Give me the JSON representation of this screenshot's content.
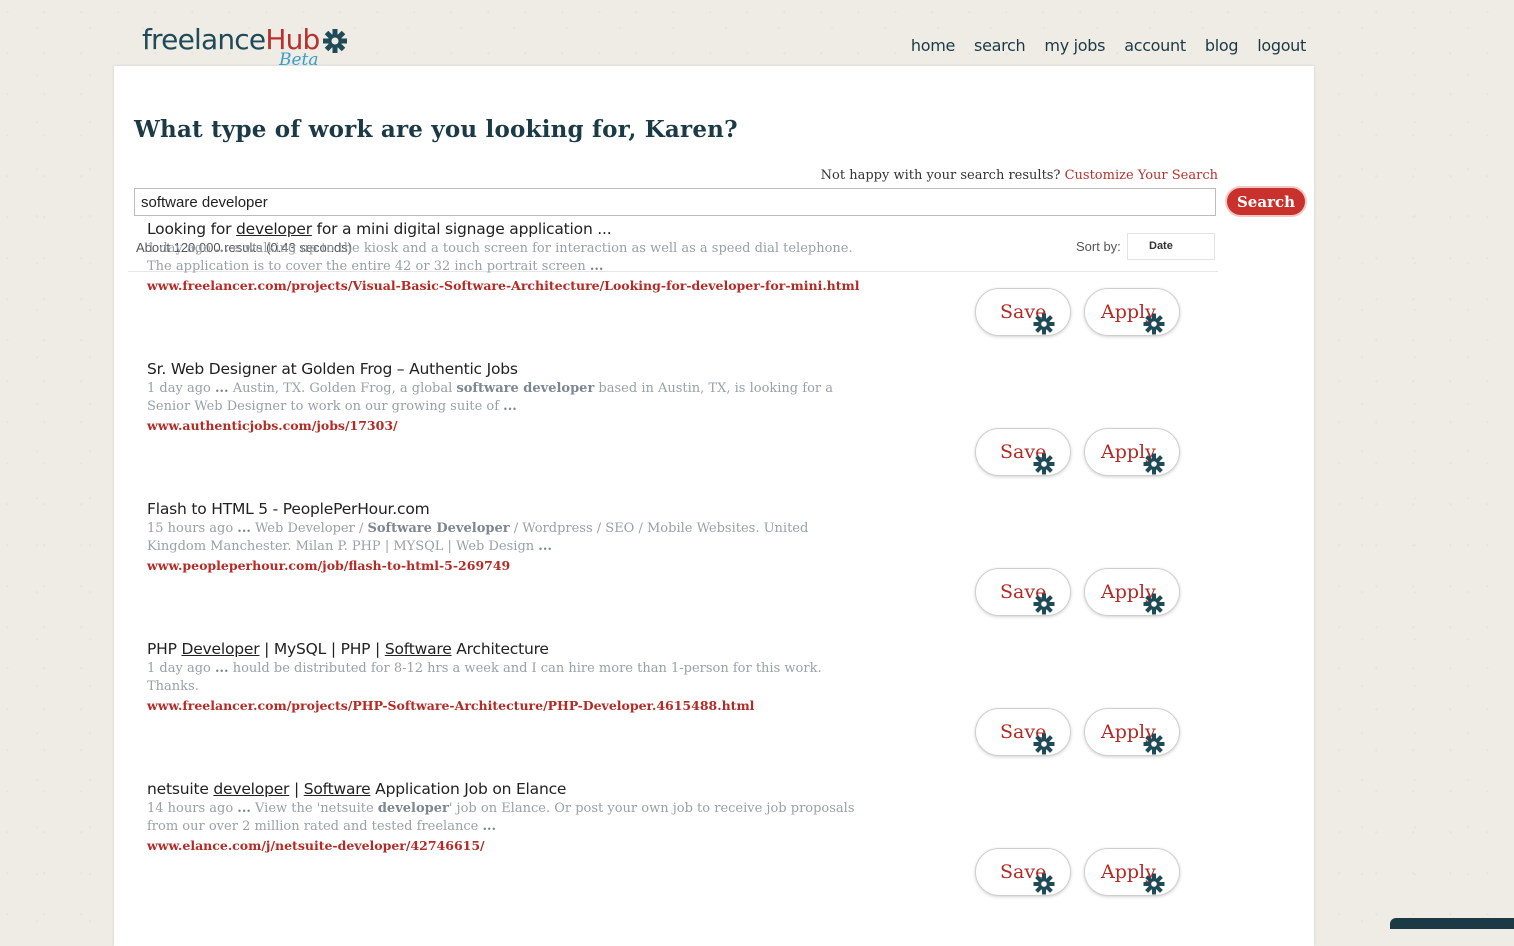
{
  "brand": {
    "name_part1": "freelance",
    "name_part2": "Hub",
    "badge": "Beta"
  },
  "nav": {
    "items": [
      "home",
      "search",
      "my jobs",
      "account",
      "blog",
      "logout"
    ]
  },
  "headline": "What type of work are you looking for, Karen?",
  "customize": {
    "prompt": "Not happy with your search results?",
    "link": "Customize Your Search"
  },
  "search": {
    "value": "software developer",
    "button": "Search"
  },
  "results_meta": {
    "count_text": "About 120,000 results (0.43 seconds)",
    "sort_label": "Sort by:",
    "sort_value": "Date"
  },
  "actions": {
    "save": "Save",
    "apply": "Apply"
  },
  "results": [
    {
      "title": "Looking for developer for a mini digital signage application ...",
      "snippet": "1 day ago ... e walking up to the kiosk and a touch screen for interaction as well as a speed dial telephone. The application is to cover the entire 42 or 32 inch portrait screen ...",
      "url": "www.freelancer.com/projects/Visual-Basic-Software-Architecture/Looking-for-developer-for-mini.html"
    },
    {
      "title": "Sr. Web Designer at Golden Frog – Authentic Jobs",
      "snippet": "1 day ago ... Austin, TX. Golden Frog, a global software developer based in Austin, TX, is looking for a Senior Web Designer to work on our growing suite of ...",
      "url": "www.authenticjobs.com/jobs/17303/"
    },
    {
      "title": "Flash to HTML 5 - PeoplePerHour.com",
      "snippet": "15 hours ago ... Web Developer / Software Developer / Wordpress / SEO / Mobile Websites. United Kingdom Manchester. Milan P. PHP | MYSQL | Web Design ...",
      "url": "www.peopleperhour.com/job/flash-to-html-5-269749"
    },
    {
      "title": "PHP Developer | MySQL | PHP | Software Architecture",
      "snippet": "1 day ago ... hould be distributed for 8-12 hrs a week and I can hire more than 1-person for this work. Thanks.",
      "url": "www.freelancer.com/projects/PHP-Software-Architecture/PHP-Developer.4615488.html"
    },
    {
      "title": "netsuite developer | Software Application Job on Elance",
      "snippet": "14 hours ago ... View the 'netsuite developer' job on Elance. Or post your own job to receive job proposals from our over 2 million rated and tested freelance ...",
      "url": "www.elance.com/j/netsuite-developer/42746615/"
    }
  ]
}
